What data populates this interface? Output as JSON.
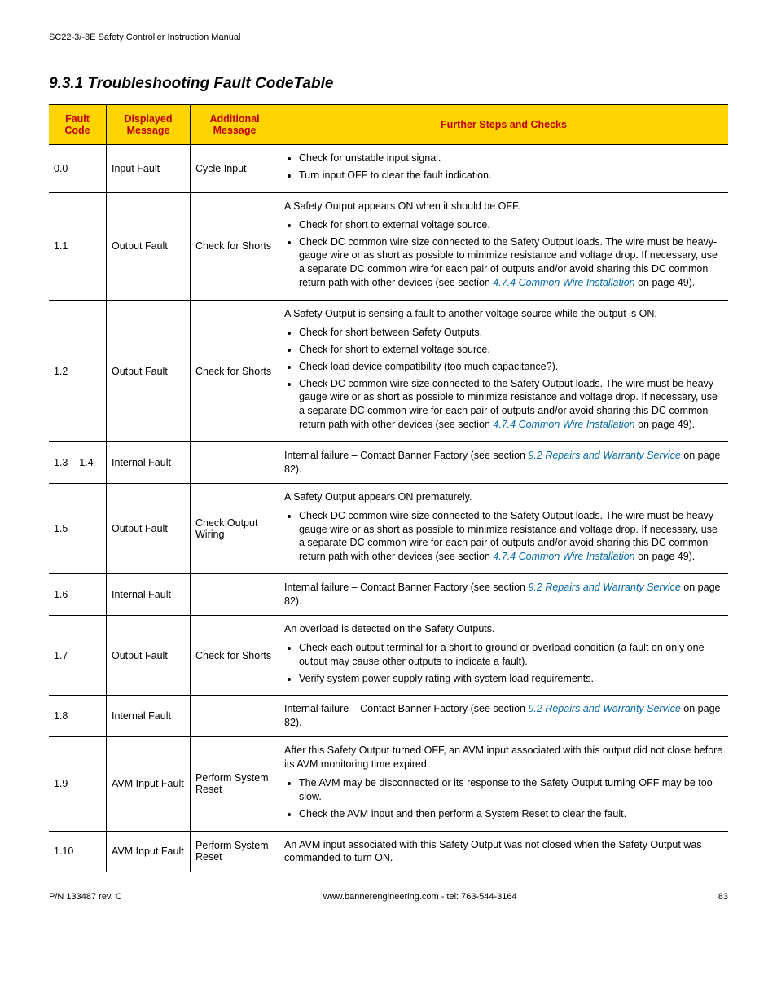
{
  "header": {
    "manual_title": "SC22-3/-3E Safety Controller Instruction Manual"
  },
  "section": {
    "number_title": "9.3.1 Troubleshooting Fault CodeTable"
  },
  "table": {
    "headers": {
      "code": "Fault Code",
      "displayed": "Displayed Message",
      "additional": "Additional Message",
      "further": "Further Steps and Checks"
    },
    "rows": [
      {
        "code": "0.0",
        "displayed": "Input Fault",
        "additional": "Cycle Input",
        "further_items": [
          "Check for unstable input signal.",
          "Turn input OFF to clear the fault indication."
        ]
      },
      {
        "code": "1.1",
        "displayed": "Output Fault",
        "additional": "Check for Shorts",
        "intro": "A Safety Output appears ON when it should be OFF.",
        "further_items": [
          "Check for short to external voltage source.",
          {
            "text_before": "Check DC common wire size connected to the Safety Output loads. The wire must be heavy-gauge wire or as short as possible to minimize resistance and voltage drop. If necessary, use a separate DC common wire for each pair of outputs and/or avoid sharing this DC common return path with other devices (see section ",
            "ref": "4.7.4 Common Wire Installation",
            "text_after": " on page 49)."
          }
        ]
      },
      {
        "code": "1.2",
        "displayed": "Output Fault",
        "additional": "Check for Shorts",
        "intro": "A Safety Output is sensing a fault to another voltage source while the output is ON.",
        "further_items": [
          "Check for short between Safety Outputs.",
          "Check for short to external voltage source.",
          "Check load device compatibility (too much capacitance?).",
          {
            "text_before": "Check DC common wire size connected to the Safety Output loads. The wire must be heavy-gauge wire or as short as possible to minimize resistance and voltage drop. If necessary, use a separate DC common wire for each pair of outputs and/or avoid sharing this DC common return path with other devices (see section ",
            "ref": "4.7.4 Common Wire Installation",
            "text_after": " on page 49)."
          }
        ]
      },
      {
        "code": "1.3 – 1.4",
        "displayed": "Internal Fault",
        "additional": "",
        "plain": {
          "text_before": "Internal failure – Contact Banner Factory (see section ",
          "ref": "9.2 Repairs and Warranty Service",
          "text_after": " on page 82)."
        }
      },
      {
        "code": "1.5",
        "displayed": "Output Fault",
        "additional": "Check Output Wiring",
        "intro": "A Safety Output appears ON prematurely.",
        "further_items": [
          {
            "text_before": "Check DC common wire size connected to the Safety Output loads. The wire must be heavy-gauge wire or as short as possible to minimize resistance and voltage drop. If necessary, use a separate DC common wire for each pair of outputs and/or avoid sharing this DC common return path with other devices (see section ",
            "ref": "4.7.4 Common Wire Installation",
            "text_after": " on page 49)."
          }
        ]
      },
      {
        "code": "1.6",
        "displayed": "Internal Fault",
        "additional": "",
        "plain": {
          "text_before": "Internal failure – Contact Banner Factory (see section ",
          "ref": "9.2 Repairs and Warranty Service",
          "text_after": " on page 82)."
        }
      },
      {
        "code": "1.7",
        "displayed": "Output Fault",
        "additional": "Check for Shorts",
        "intro": "An overload is detected on the Safety Outputs.",
        "further_items": [
          "Check each output terminal for a short to ground or overload condition (a fault on only one output may cause other outputs to indicate a fault).",
          "Verify system power supply rating with system load requirements."
        ]
      },
      {
        "code": "1.8",
        "displayed": "Internal Fault",
        "additional": "",
        "plain": {
          "text_before": "Internal failure – Contact Banner Factory (see section ",
          "ref": "9.2 Repairs and Warranty Service",
          "text_after": " on page 82)."
        }
      },
      {
        "code": "1.9",
        "displayed": "AVM Input Fault",
        "additional": "Perform System Reset",
        "intro": "After this Safety Output turned OFF, an AVM input associated with this output did not close before its AVM monitoring time expired.",
        "further_items": [
          "The AVM may be disconnected or its response to the Safety Output turning OFF may be too slow.",
          "Check the AVM input and then perform a System Reset to clear the fault."
        ]
      },
      {
        "code": "1.10",
        "displayed": "AVM Input Fault",
        "additional": "Perform System Reset",
        "plain": {
          "text_before": "An AVM input associated with this Safety Output was not closed when the Safety Output was commanded to turn ON.",
          "ref": "",
          "text_after": ""
        }
      }
    ]
  },
  "footer": {
    "left": "P/N 133487 rev. C",
    "center": "www.bannerengineering.com - tel: 763-544-3164",
    "right": "83"
  }
}
